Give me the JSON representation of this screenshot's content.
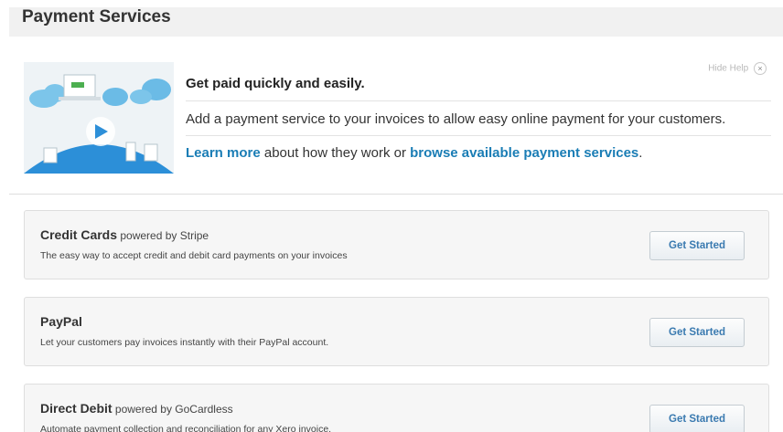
{
  "header": {
    "title": "Payment Services"
  },
  "help": {
    "hide_label": "Hide Help",
    "close_glyph": "×",
    "heading": "Get paid quickly and easily.",
    "description": "Add a payment service to your invoices to allow easy online payment for your customers.",
    "learn_more_link": "Learn more",
    "links_middle_text": " about how they work or ",
    "browse_link": "browse available payment services",
    "links_end_text": ".",
    "illustration_icons": [
      "cloud-icon",
      "laptop-icon",
      "video-play-icon",
      "building-icon",
      "globe-icon"
    ]
  },
  "services": [
    {
      "name": "Credit Cards",
      "powered_by": " powered by Stripe",
      "description": "The easy way to accept credit and debit card payments on your invoices",
      "button_label": "Get Started"
    },
    {
      "name": "PayPal",
      "powered_by": "",
      "description": "Let your customers pay invoices instantly with their PayPal account.",
      "button_label": "Get Started"
    },
    {
      "name": "Direct Debit",
      "powered_by": " powered by GoCardless",
      "description": "Automate payment collection and reconciliation for any Xero invoice.",
      "button_label": "Get Started"
    }
  ],
  "colors": {
    "link": "#1a7db5",
    "button_text": "#3a7ab0",
    "header_bg": "#f1f1f1",
    "card_bg": "#f6f6f6"
  }
}
